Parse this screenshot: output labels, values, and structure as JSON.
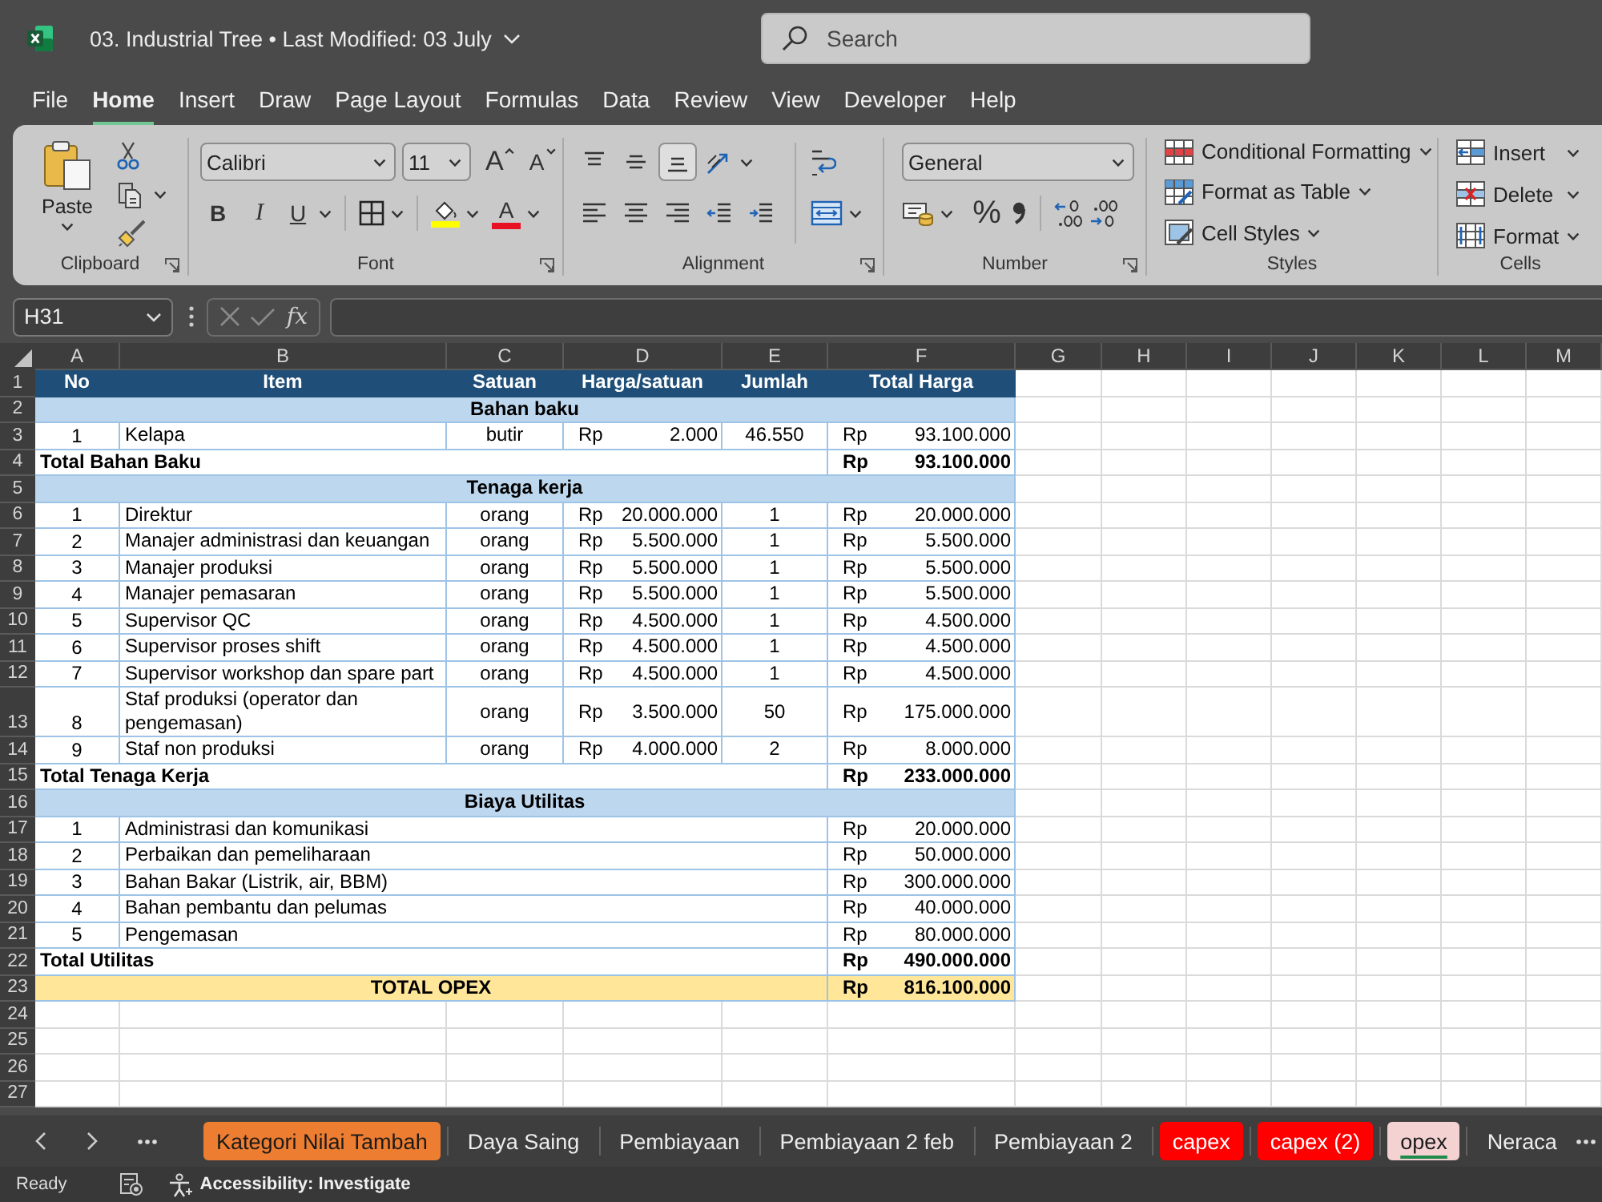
{
  "window": {
    "title": "03. Industrial Tree • Last Modified: 03 July"
  },
  "search": {
    "placeholder": "Search"
  },
  "ribbon_tabs": [
    {
      "label": "File",
      "selected": false
    },
    {
      "label": "Home",
      "selected": true
    },
    {
      "label": "Insert",
      "selected": false
    },
    {
      "label": "Draw",
      "selected": false
    },
    {
      "label": "Page Layout",
      "selected": false
    },
    {
      "label": "Formulas",
      "selected": false
    },
    {
      "label": "Data",
      "selected": false
    },
    {
      "label": "Review",
      "selected": false
    },
    {
      "label": "View",
      "selected": false
    },
    {
      "label": "Developer",
      "selected": false
    },
    {
      "label": "Help",
      "selected": false
    }
  ],
  "ribbon": {
    "clipboard": {
      "title": "Clipboard",
      "paste": "Paste"
    },
    "font": {
      "title": "Font",
      "font_name": "Calibri",
      "font_size": "11",
      "grow_font": "A",
      "shrink_font": "A",
      "bold": "B",
      "italic": "I",
      "underline": "U",
      "font_color": "A"
    },
    "alignment": {
      "title": "Alignment",
      "vertical": [
        {
          "kind": "top",
          "selected": false
        },
        {
          "kind": "middle",
          "selected": false
        },
        {
          "kind": "bottom",
          "selected": true
        }
      ]
    },
    "number": {
      "title": "Number",
      "format": "General",
      "percent": "%"
    },
    "styles": {
      "title": "Styles",
      "items": [
        {
          "kind": "conditional",
          "label": "Conditional Formatting"
        },
        {
          "kind": "table",
          "label": "Format as Table"
        },
        {
          "kind": "cell_styles",
          "label": "Cell Styles"
        }
      ]
    },
    "cells": {
      "title": "Cells",
      "items": [
        {
          "kind": "insert",
          "label": "Insert"
        },
        {
          "kind": "delete",
          "label": "Delete"
        },
        {
          "kind": "format",
          "label": "Format"
        }
      ]
    }
  },
  "formula_bar": {
    "name_box": "H31",
    "function_button": "fx"
  },
  "sheet": {
    "columns": [
      "A",
      "B",
      "C",
      "D",
      "E",
      "F",
      "G",
      "H",
      "I",
      "J",
      "K",
      "L",
      "M"
    ],
    "rows": [
      {
        "number": "1",
        "kind": "header",
        "cells": [
          "No",
          "Item",
          "Satuan",
          "Harga/satuan",
          "Jumlah",
          "Total Harga"
        ]
      },
      {
        "number": "2",
        "kind": "section",
        "label": "Bahan baku"
      },
      {
        "number": "3",
        "kind": "item",
        "no": "1",
        "item": "Kelapa",
        "unit": "butir",
        "price_currency": "Rp",
        "price": "2.000",
        "quantity": "46.550",
        "total_currency": "Rp",
        "total": "93.100.000"
      },
      {
        "number": "4",
        "kind": "subtotal",
        "label": "Total Bahan Baku",
        "total_currency": "Rp",
        "total": "93.100.000"
      },
      {
        "number": "5",
        "kind": "section",
        "label": "Tenaga kerja"
      },
      {
        "number": "6",
        "kind": "item",
        "no": "1",
        "item": "Direktur",
        "unit": "orang",
        "price_currency": "Rp",
        "price": "20.000.000",
        "quantity": "1",
        "total_currency": "Rp",
        "total": "20.000.000"
      },
      {
        "number": "7",
        "kind": "item",
        "no": "2",
        "item": "Manajer administrasi dan keuangan",
        "unit": "orang",
        "price_currency": "Rp",
        "price": "5.500.000",
        "quantity": "1",
        "total_currency": "Rp",
        "total": "5.500.000"
      },
      {
        "number": "8",
        "kind": "item",
        "no": "3",
        "item": "Manajer produksi",
        "unit": "orang",
        "price_currency": "Rp",
        "price": "5.500.000",
        "quantity": "1",
        "total_currency": "Rp",
        "total": "5.500.000"
      },
      {
        "number": "9",
        "kind": "item",
        "no": "4",
        "item": "Manajer pemasaran",
        "unit": "orang",
        "price_currency": "Rp",
        "price": "5.500.000",
        "quantity": "1",
        "total_currency": "Rp",
        "total": "5.500.000"
      },
      {
        "number": "10",
        "kind": "item",
        "no": "5",
        "item": "Supervisor QC",
        "unit": "orang",
        "price_currency": "Rp",
        "price": "4.500.000",
        "quantity": "1",
        "total_currency": "Rp",
        "total": "4.500.000"
      },
      {
        "number": "11",
        "kind": "item",
        "no": "6",
        "item": "Supervisor proses shift",
        "unit": "orang",
        "price_currency": "Rp",
        "price": "4.500.000",
        "quantity": "1",
        "total_currency": "Rp",
        "total": "4.500.000"
      },
      {
        "number": "12",
        "kind": "item",
        "no": "7",
        "item": "Supervisor workshop dan spare part",
        "unit": "orang",
        "price_currency": "Rp",
        "price": "4.500.000",
        "quantity": "1",
        "total_currency": "Rp",
        "total": "4.500.000"
      },
      {
        "number": "13",
        "kind": "item",
        "no": "8",
        "item": "Staf produksi (operator dan pengemasan)",
        "unit": "orang",
        "price_currency": "Rp",
        "price": "3.500.000",
        "quantity": "50",
        "total_currency": "Rp",
        "total": "175.000.000"
      },
      {
        "number": "14",
        "kind": "item",
        "no": "9",
        "item": "Staf non produksi",
        "unit": "orang",
        "price_currency": "Rp",
        "price": "4.000.000",
        "quantity": "2",
        "total_currency": "Rp",
        "total": "8.000.000"
      },
      {
        "number": "15",
        "kind": "subtotal",
        "label": "Total Tenaga Kerja",
        "total_currency": "Rp",
        "total": "233.000.000"
      },
      {
        "number": "16",
        "kind": "section",
        "label": "Biaya Utilitas"
      },
      {
        "number": "17",
        "kind": "cost",
        "no": "1",
        "item": "Administrasi dan komunikasi",
        "total_currency": "Rp",
        "total": "20.000.000"
      },
      {
        "number": "18",
        "kind": "cost",
        "no": "2",
        "item": "Perbaikan dan pemeliharaan",
        "total_currency": "Rp",
        "total": "50.000.000"
      },
      {
        "number": "19",
        "kind": "cost",
        "no": "3",
        "item": "Bahan Bakar (Listrik, air, BBM)",
        "total_currency": "Rp",
        "total": "300.000.000"
      },
      {
        "number": "20",
        "kind": "cost",
        "no": "4",
        "item": "Bahan pembantu dan pelumas",
        "total_currency": "Rp",
        "total": "40.000.000"
      },
      {
        "number": "21",
        "kind": "cost",
        "no": "5",
        "item": "Pengemasan",
        "total_currency": "Rp",
        "total": "80.000.000"
      },
      {
        "number": "22",
        "kind": "subtotal",
        "label": "Total Utilitas",
        "total_currency": "Rp",
        "total": "490.000.000"
      },
      {
        "number": "23",
        "kind": "grand_total",
        "label": "TOTAL OPEX",
        "total_currency": "Rp",
        "total": "816.100.000"
      },
      {
        "number": "24",
        "kind": "empty"
      },
      {
        "number": "25",
        "kind": "empty"
      },
      {
        "number": "26",
        "kind": "empty"
      },
      {
        "number": "27",
        "kind": "empty"
      }
    ]
  },
  "sheet_tabs": [
    {
      "label": "Kategori Nilai Tambah",
      "selected": false,
      "color": "#ed7d31"
    },
    {
      "label": "Daya Saing",
      "selected": false
    },
    {
      "label": "Pembiayaan",
      "selected": false
    },
    {
      "label": "Pembiayaan 2 feb",
      "selected": false
    },
    {
      "label": "Pembiayaan 2",
      "selected": false
    },
    {
      "label": "capex",
      "selected": false,
      "color": "#ff0000"
    },
    {
      "label": "capex (2)",
      "selected": false,
      "color": "#ff0000"
    },
    {
      "label": "opex",
      "selected": true,
      "color": "#f4d2d2"
    },
    {
      "label": "Neraca",
      "selected": false
    }
  ],
  "status_bar": {
    "mode": "Ready",
    "accessibility": "Accessibility: Investigate"
  }
}
